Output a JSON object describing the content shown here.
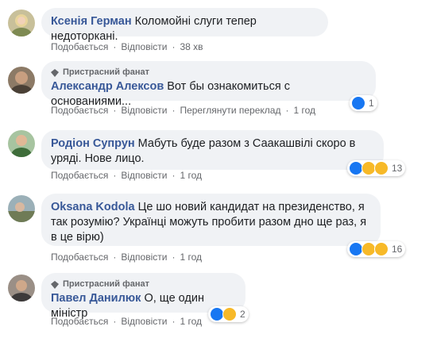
{
  "comments": [
    {
      "author": "Ксенія Герман",
      "text": "Коломойні слуги тепер недоторкані.",
      "actions": {
        "like": "Подобається",
        "reply": "Відповісти",
        "time": "38 хв"
      }
    },
    {
      "badge": "Пристрасний фанат",
      "author": "Александр Алексов",
      "text": "Вот бы ознакомиться с основаниями...",
      "actions": {
        "like": "Подобається",
        "reply": "Відповісти",
        "translate": "Переглянути переклад",
        "time": "1 год"
      },
      "reactions": {
        "count": "1",
        "icons": [
          "like-icon"
        ]
      }
    },
    {
      "author": "Родіон Супрун",
      "text": "Мабуть буде разом з Саакашвілі скоро в уряді. Нове лицо.",
      "actions": {
        "like": "Подобається",
        "reply": "Відповісти",
        "time": "1 год"
      },
      "reactions": {
        "count": "13",
        "icons": [
          "like-icon",
          "sad-icon",
          "haha-icon"
        ]
      }
    },
    {
      "author": "Oksana Kodola",
      "text": "Це шо новий кандидат на президенство, я так розумію? Українці можуть пробити разом дно ще раз, я в це вірю)",
      "actions": {
        "like": "Подобається",
        "reply": "Відповісти",
        "time": "1 год"
      },
      "reactions": {
        "count": "16",
        "icons": [
          "like-icon",
          "sad-icon",
          "haha-icon"
        ]
      }
    },
    {
      "badge": "Пристрасний фанат",
      "author": "Павел Данилюк",
      "text": "О, ще один міністр",
      "actions": {
        "like": "Подобається",
        "reply": "Відповісти",
        "time": "1 год"
      },
      "reactions": {
        "count": "2",
        "icons": [
          "like-icon",
          "haha-icon"
        ]
      }
    }
  ],
  "colors": {
    "link": "#385898",
    "bubble": "#f0f2f5",
    "meta": "#65676b",
    "like": "#1877f2",
    "emoji": "#f7b928"
  }
}
